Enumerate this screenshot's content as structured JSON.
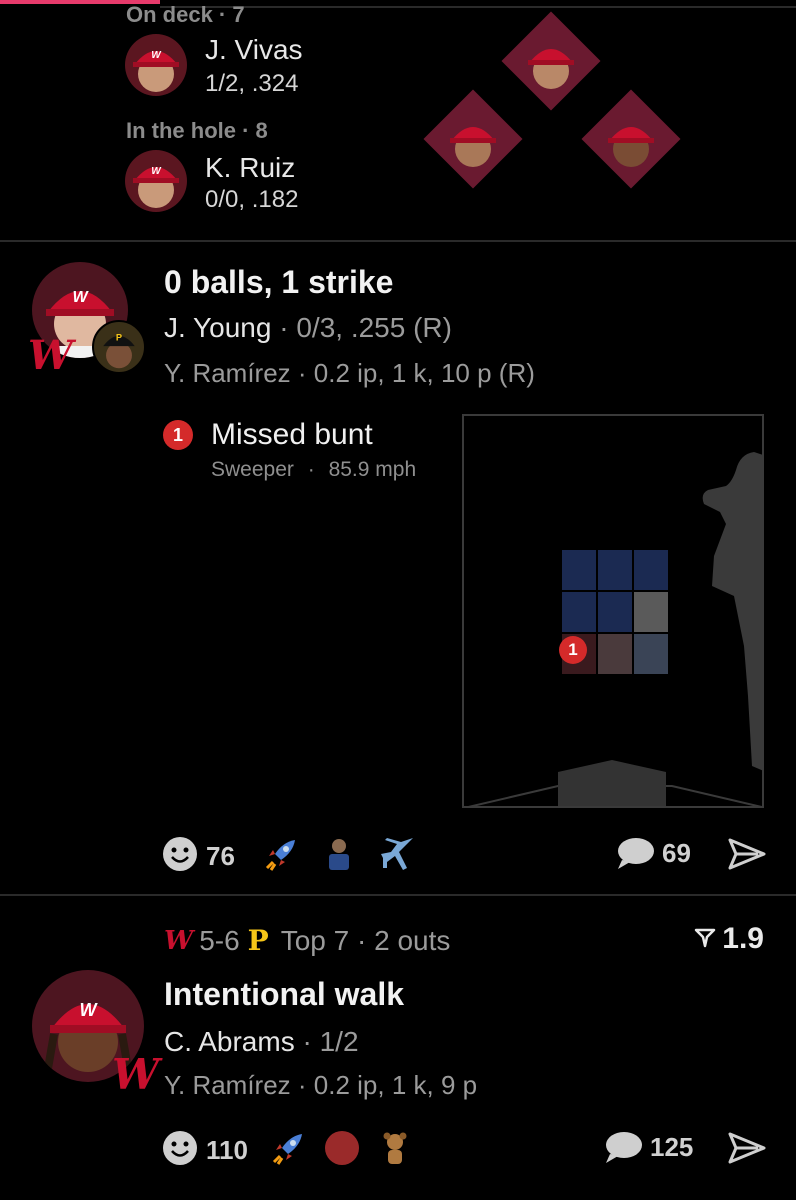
{
  "upcoming": {
    "on_deck_label": "On deck · 7",
    "on_deck_name": "J. Vivas",
    "on_deck_stat": "1/2, .324",
    "in_hole_label": "In the hole · 8",
    "in_hole_name": "K. Ruiz",
    "in_hole_stat": "0/0, .182"
  },
  "play1": {
    "title": "0 balls, 1 strike",
    "batter_name": "J. Young",
    "batter_stat": "· 0/3, .255 (R)",
    "pitcher_line": "Y. Ramírez · 0.2 ip, 1 k, 10 p (R)",
    "pitch_number": "1",
    "pitch_result": "Missed bunt",
    "pitch_type": "Sweeper",
    "pitch_speed": "85.9 mph",
    "pitch_sep": "·",
    "reaction_count": "76",
    "comment_count": "69"
  },
  "play2": {
    "score": "5-6",
    "inning_info": "Top 7 · 2 outs",
    "win_prob_delta": "1.9",
    "title": "Intentional walk",
    "batter_name": "C. Abrams",
    "batter_stat": "· 1/2",
    "pitcher_line": "Y. Ramírez · 0.2 ip, 1 k, 9 p",
    "reaction_count": "110",
    "comment_count": "125"
  },
  "colors": {
    "nationals_red": "#c8102e",
    "pirates_gold": "#f5c518",
    "accent_pink": "#e63a6b",
    "badge_red": "#d42a2a"
  },
  "icons": [
    "smiley-icon",
    "rocket-icon",
    "comment-icon",
    "share-icon",
    "airplane-icon",
    "flag-icon"
  ]
}
